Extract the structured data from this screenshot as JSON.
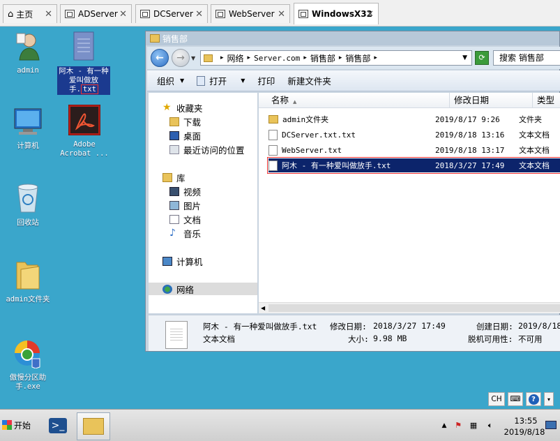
{
  "tabs": [
    {
      "label": "主页"
    },
    {
      "label": "ADServer"
    },
    {
      "label": "DCServer"
    },
    {
      "label": "WebServer"
    },
    {
      "label": "WindowsX32"
    }
  ],
  "desktop": {
    "admin": "admin",
    "file_label": "阿木 - 有一种爱叫做放手.",
    "file_ext": "txt",
    "computer": "计算机",
    "acrobat": "Adobe Acrobat ...",
    "recycle": "回收站",
    "admin_folder": "admin文件夹",
    "partition": "傲慢分区助手.exe"
  },
  "window": {
    "title": "销售部",
    "breadcrumb": [
      "网络",
      "Server.com",
      "销售部",
      "销售部"
    ],
    "search_placeholder": "搜索 销售部",
    "toolbar": {
      "organize": "组织",
      "open": "打开",
      "print": "打印",
      "new_folder": "新建文件夹"
    },
    "nav": {
      "favorites": "收藏夹",
      "downloads": "下载",
      "desktop": "桌面",
      "recent": "最近访问的位置",
      "libraries": "库",
      "videos": "视频",
      "pictures": "图片",
      "documents": "文档",
      "music": "音乐",
      "computer": "计算机",
      "network": "网络"
    },
    "columns": {
      "name": "名称",
      "date": "修改日期",
      "type": "类型"
    },
    "files": [
      {
        "name": "admin文件夹",
        "date": "2019/8/17 9:26",
        "type": "文件夹"
      },
      {
        "name": "DCServer.txt.txt",
        "date": "2019/8/18 13:16",
        "type": "文本文档"
      },
      {
        "name": "WebServer.txt",
        "date": "2019/8/18 13:17",
        "type": "文本文档"
      },
      {
        "name": "阿木 - 有一种爱叫做放手.txt",
        "date": "2018/3/27 17:49",
        "type": "文本文档"
      }
    ],
    "details": {
      "filename": "阿木 - 有一种爱叫做放手.txt",
      "modified_label": "修改日期:",
      "modified_value": "2018/3/27 17:49",
      "created_label": "创建日期:",
      "created_value": "2019/8/18",
      "type": "文本文档",
      "size_label": "大小:",
      "size_value": "9.98 MB",
      "offline_label": "脱机可用性:",
      "offline_value": "不可用"
    }
  },
  "langbar": {
    "lang": "CH"
  },
  "taskbar": {
    "start": "开始",
    "time": "13:55",
    "date": "2019/8/18"
  }
}
